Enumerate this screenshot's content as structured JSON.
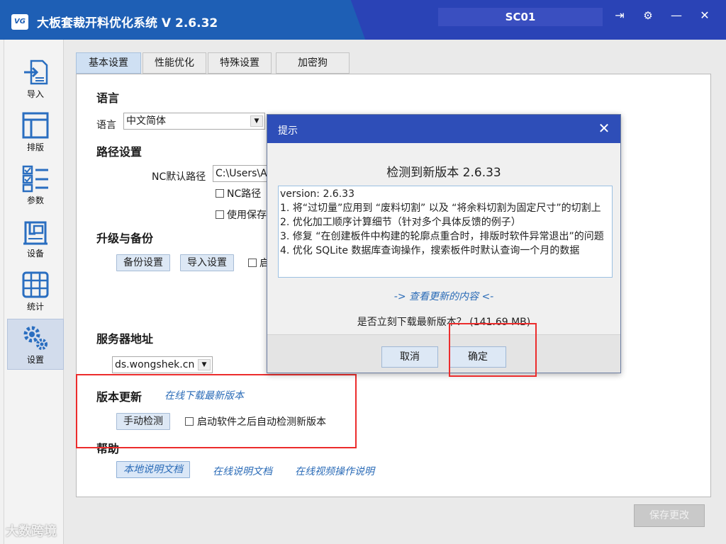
{
  "window": {
    "logo_text": "VG",
    "title": "大板套裁开料优化系统  V 2.6.32",
    "station": "SC01",
    "controls": {
      "exit": "⇥",
      "settings": "⚙",
      "minimize": "—",
      "maximize": "☐",
      "close": "✕"
    }
  },
  "sidebar": {
    "items": [
      {
        "label": "导入",
        "icon": "import-icon"
      },
      {
        "label": "排版",
        "icon": "layout-icon"
      },
      {
        "label": "参数",
        "icon": "parameters-icon"
      },
      {
        "label": "设备",
        "icon": "device-icon"
      },
      {
        "label": "统计",
        "icon": "statistics-icon"
      },
      {
        "label": "设置",
        "icon": "settings-icon",
        "active": true
      }
    ]
  },
  "tabs": [
    {
      "label": "基本设置",
      "active": true
    },
    {
      "label": "性能优化"
    },
    {
      "label": "特殊设置"
    },
    {
      "label": "加密狗"
    }
  ],
  "settings": {
    "language": {
      "section": "语言",
      "label": "语言",
      "value": "中文简体"
    },
    "path": {
      "section": "路径设置",
      "nc_label": "NC默认路径",
      "nc_value": "C:\\Users\\A",
      "cb1": "NC路径",
      "cb2": "使用保存"
    },
    "upgrade": {
      "section": "升级与备份",
      "backup_btn": "备份设置",
      "import_btn": "导入设置",
      "cb": "启"
    },
    "server": {
      "section": "服务器地址",
      "value": "ds.wongshek.cn"
    },
    "update": {
      "section": "版本更新",
      "online_link": "在线下载最新版本",
      "manual_btn": "手动检测",
      "auto_check": "启动软件之后自动检测新版本"
    },
    "help": {
      "section": "帮助",
      "local_doc": "本地说明文档",
      "online_doc": "在线说明文档",
      "video_doc": "在线视频操作说明"
    },
    "save_btn": "保存更改"
  },
  "dialog": {
    "title": "提示",
    "close": "✕",
    "headline": "检测到新版本 2.6.33",
    "notes": [
      "version: 2.6.33",
      "1. 将“过切量”应用到 “废料切割” 以及 “将余料切割为固定尺寸”的切割上",
      "2. 优化加工顺序计算细节（针对多个具体反馈的例子）",
      "3. 修复 “在创建板件中构建的轮廓点重合时，排版时软件异常退出”的问题",
      "4. 优化 SQLite 数据库查询操作，搜索板件时默认查询一个月的数据"
    ],
    "view_link": "-> 查看更新的内容 <-",
    "question": "是否立刻下载最新版本？ (141.69 MB)",
    "cancel": "取消",
    "confirm": "确定"
  },
  "watermark": "大数跨境"
}
